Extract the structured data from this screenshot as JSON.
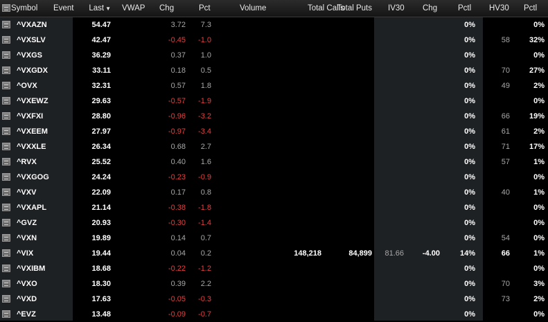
{
  "columns": {
    "symbol": "Symbol",
    "event": "Event",
    "last": "Last",
    "sort_arrow": "▼",
    "vwap": "VWAP",
    "chg": "Chg",
    "pct": "Pct",
    "volume": "Volume",
    "total_calls": "Total Calls",
    "total_puts": "Total Puts",
    "iv30": "IV30",
    "iv_chg": "Chg",
    "iv_pctl": "Pctl",
    "hv30": "HV30",
    "hv_pctl": "Pctl"
  },
  "icons": {
    "row_icon": "chart-icon"
  },
  "colors": {
    "negative": "#e04040",
    "neutral": "#a8a8a8",
    "column_band": "#1e2124"
  },
  "rows": [
    {
      "symbol": "^VXAZN",
      "last": "54.47",
      "chg": "3.72",
      "pct": "7.3",
      "neg": false,
      "total_calls": "",
      "total_puts": "",
      "iv30": "",
      "iv_chg": "",
      "iv_pctl": "0%",
      "hv30": "",
      "hv_pctl": "0%"
    },
    {
      "symbol": "^VXSLV",
      "last": "42.47",
      "chg": "-0.45",
      "pct": "-1.0",
      "neg": true,
      "total_calls": "",
      "total_puts": "",
      "iv30": "",
      "iv_chg": "",
      "iv_pctl": "0%",
      "hv30": "58",
      "hv_pctl": "32%"
    },
    {
      "symbol": "^VXGS",
      "last": "36.29",
      "chg": "0.37",
      "pct": "1.0",
      "neg": false,
      "total_calls": "",
      "total_puts": "",
      "iv30": "",
      "iv_chg": "",
      "iv_pctl": "0%",
      "hv30": "",
      "hv_pctl": "0%"
    },
    {
      "symbol": "^VXGDX",
      "last": "33.11",
      "chg": "0.18",
      "pct": "0.5",
      "neg": false,
      "total_calls": "",
      "total_puts": "",
      "iv30": "",
      "iv_chg": "",
      "iv_pctl": "0%",
      "hv30": "70",
      "hv_pctl": "27%"
    },
    {
      "symbol": "^OVX",
      "last": "32.31",
      "chg": "0.57",
      "pct": "1.8",
      "neg": false,
      "total_calls": "",
      "total_puts": "",
      "iv30": "",
      "iv_chg": "",
      "iv_pctl": "0%",
      "hv30": "49",
      "hv_pctl": "2%"
    },
    {
      "symbol": "^VXEWZ",
      "last": "29.63",
      "chg": "-0.57",
      "pct": "-1.9",
      "neg": true,
      "total_calls": "",
      "total_puts": "",
      "iv30": "",
      "iv_chg": "",
      "iv_pctl": "0%",
      "hv30": "",
      "hv_pctl": "0%"
    },
    {
      "symbol": "^VXFXI",
      "last": "28.80",
      "chg": "-0.96",
      "pct": "-3.2",
      "neg": true,
      "total_calls": "",
      "total_puts": "",
      "iv30": "",
      "iv_chg": "",
      "iv_pctl": "0%",
      "hv30": "66",
      "hv_pctl": "19%"
    },
    {
      "symbol": "^VXEEM",
      "last": "27.97",
      "chg": "-0.97",
      "pct": "-3.4",
      "neg": true,
      "total_calls": "",
      "total_puts": "",
      "iv30": "",
      "iv_chg": "",
      "iv_pctl": "0%",
      "hv30": "61",
      "hv_pctl": "2%"
    },
    {
      "symbol": "^VXXLE",
      "last": "26.34",
      "chg": "0.68",
      "pct": "2.7",
      "neg": false,
      "total_calls": "",
      "total_puts": "",
      "iv30": "",
      "iv_chg": "",
      "iv_pctl": "0%",
      "hv30": "71",
      "hv_pctl": "17%"
    },
    {
      "symbol": "^RVX",
      "last": "25.52",
      "chg": "0.40",
      "pct": "1.6",
      "neg": false,
      "total_calls": "",
      "total_puts": "",
      "iv30": "",
      "iv_chg": "",
      "iv_pctl": "0%",
      "hv30": "57",
      "hv_pctl": "1%"
    },
    {
      "symbol": "^VXGOG",
      "last": "24.24",
      "chg": "-0.23",
      "pct": "-0.9",
      "neg": true,
      "total_calls": "",
      "total_puts": "",
      "iv30": "",
      "iv_chg": "",
      "iv_pctl": "0%",
      "hv30": "",
      "hv_pctl": "0%"
    },
    {
      "symbol": "^VXV",
      "last": "22.09",
      "chg": "0.17",
      "pct": "0.8",
      "neg": false,
      "total_calls": "",
      "total_puts": "",
      "iv30": "",
      "iv_chg": "",
      "iv_pctl": "0%",
      "hv30": "40",
      "hv_pctl": "1%"
    },
    {
      "symbol": "^VXAPL",
      "last": "21.14",
      "chg": "-0.38",
      "pct": "-1.8",
      "neg": true,
      "total_calls": "",
      "total_puts": "",
      "iv30": "",
      "iv_chg": "",
      "iv_pctl": "0%",
      "hv30": "",
      "hv_pctl": "0%"
    },
    {
      "symbol": "^GVZ",
      "last": "20.93",
      "chg": "-0.30",
      "pct": "-1.4",
      "neg": true,
      "total_calls": "",
      "total_puts": "",
      "iv30": "",
      "iv_chg": "",
      "iv_pctl": "0%",
      "hv30": "",
      "hv_pctl": "0%"
    },
    {
      "symbol": "^VXN",
      "last": "19.89",
      "chg": "0.14",
      "pct": "0.7",
      "neg": false,
      "total_calls": "",
      "total_puts": "",
      "iv30": "",
      "iv_chg": "",
      "iv_pctl": "0%",
      "hv30": "54",
      "hv_pctl": "0%"
    },
    {
      "symbol": "^VIX",
      "last": "19.44",
      "chg": "0.04",
      "pct": "0.2",
      "neg": false,
      "total_calls": "148,218",
      "total_puts": "84,899",
      "iv30": "81.66",
      "iv_chg": "-4.00",
      "iv_pctl": "14%",
      "hv30": "66",
      "hv_pctl": "1%",
      "highlight": true
    },
    {
      "symbol": "^VXIBM",
      "last": "18.68",
      "chg": "-0.22",
      "pct": "-1.2",
      "neg": true,
      "total_calls": "",
      "total_puts": "",
      "iv30": "",
      "iv_chg": "",
      "iv_pctl": "0%",
      "hv30": "",
      "hv_pctl": "0%"
    },
    {
      "symbol": "^VXO",
      "last": "18.30",
      "chg": "0.39",
      "pct": "2.2",
      "neg": false,
      "total_calls": "",
      "total_puts": "",
      "iv30": "",
      "iv_chg": "",
      "iv_pctl": "0%",
      "hv30": "70",
      "hv_pctl": "3%"
    },
    {
      "symbol": "^VXD",
      "last": "17.63",
      "chg": "-0.05",
      "pct": "-0.3",
      "neg": true,
      "total_calls": "",
      "total_puts": "",
      "iv30": "",
      "iv_chg": "",
      "iv_pctl": "0%",
      "hv30": "73",
      "hv_pctl": "2%"
    },
    {
      "symbol": "^EVZ",
      "last": "13.48",
      "chg": "-0.09",
      "pct": "-0.7",
      "neg": true,
      "total_calls": "",
      "total_puts": "",
      "iv30": "",
      "iv_chg": "",
      "iv_pctl": "0%",
      "hv30": "",
      "hv_pctl": "0%"
    }
  ]
}
